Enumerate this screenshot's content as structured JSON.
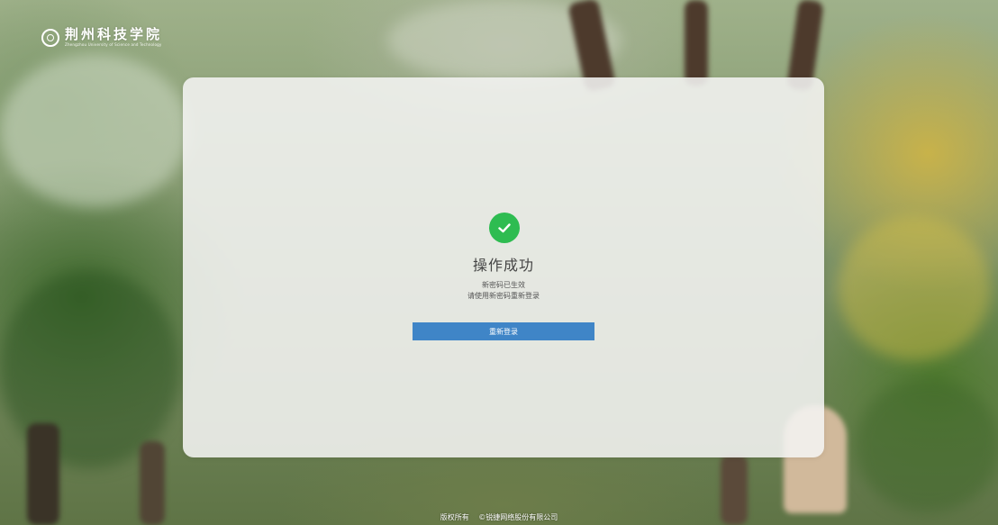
{
  "header": {
    "logo_name": "荆州科技学院",
    "logo_subtitle": "Zhengzhou University of Science and Technology"
  },
  "result": {
    "icon": "check-circle-icon",
    "icon_color": "#2ebc51",
    "title": "操作成功",
    "message_line1": "新密码已生效",
    "message_line2": "请使用新密码重新登录",
    "button_label": "重新登录",
    "button_color": "#3f85c7"
  },
  "footer": {
    "copyright": "版权所有",
    "company": "©锐捷网络股份有限公司"
  }
}
